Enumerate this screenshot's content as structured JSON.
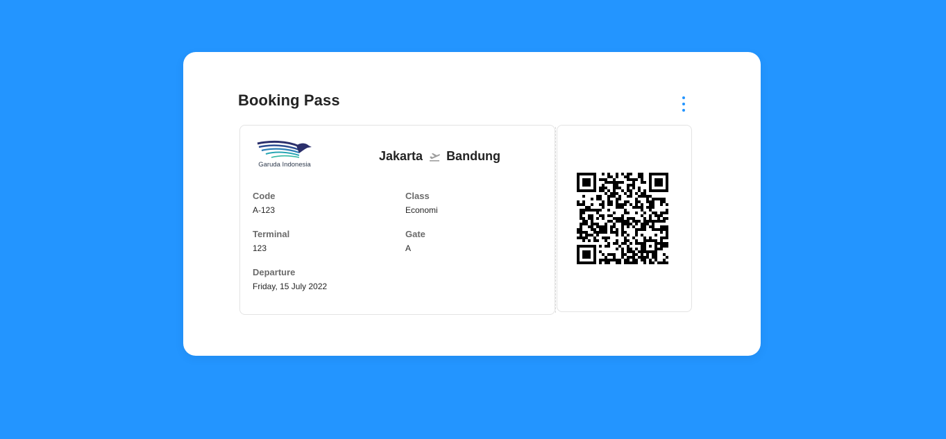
{
  "page": {
    "title": "Booking Pass"
  },
  "colors": {
    "background": "#2395ff",
    "accent": "#2395ff",
    "card": "#ffffff"
  },
  "icons": {
    "menu": "more-vertical-icon",
    "plane": "airplane-takeoff-icon",
    "logo": "garuda-indonesia-logo",
    "qr": "qr-code"
  },
  "ticket": {
    "airline": "Garuda Indonesia",
    "from": "Jakarta",
    "to": "Bandung",
    "fields": {
      "code": {
        "label": "Code",
        "value": "A-123"
      },
      "class": {
        "label": "Class",
        "value": "Economi"
      },
      "terminal": {
        "label": "Terminal",
        "value": "123"
      },
      "gate": {
        "label": "Gate",
        "value": "A"
      },
      "departure": {
        "label": "Departure",
        "value": "Friday, 15 July 2022"
      }
    }
  }
}
